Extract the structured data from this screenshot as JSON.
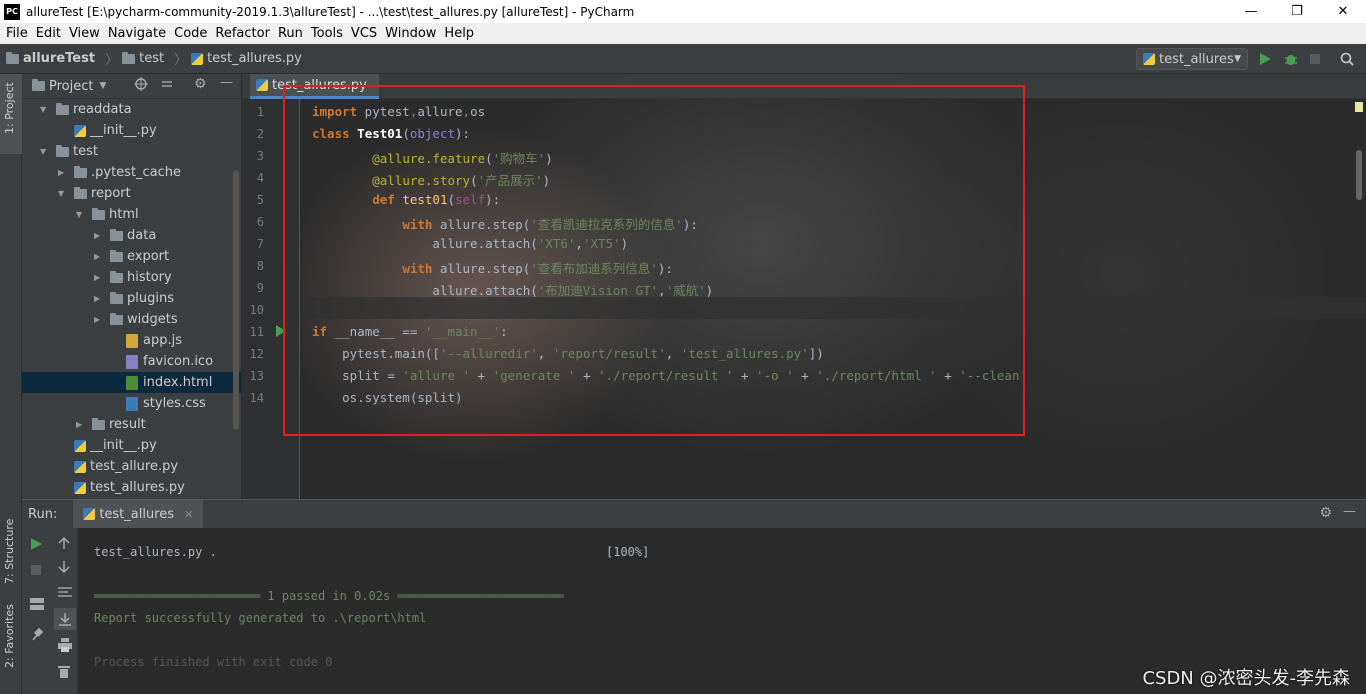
{
  "window": {
    "title": "allureTest [E:\\pycharm-community-2019.1.3\\allureTest] - ...\\test\\test_allures.py [allureTest] - PyCharm",
    "logo_text": "PC",
    "minimize": "—",
    "restore": "❐",
    "close": "✕"
  },
  "menu": [
    "File",
    "Edit",
    "View",
    "Navigate",
    "Code",
    "Refactor",
    "Run",
    "Tools",
    "VCS",
    "Window",
    "Help"
  ],
  "breadcrumb": {
    "project": "allureTest",
    "folder": "test",
    "file": "test_allures.py"
  },
  "run_config": "test_allures",
  "project_panel": {
    "title": "Project",
    "side_tabs": {
      "project": "1: Project",
      "structure": "7: Structure",
      "favorites": "2: Favorites"
    },
    "tree": [
      {
        "label": "readdata",
        "kind": "folder",
        "level": 0,
        "expanded": true
      },
      {
        "label": "__init__.py",
        "kind": "py",
        "level": 1
      },
      {
        "label": "test",
        "kind": "folder",
        "level": 0,
        "expanded": true
      },
      {
        "label": ".pytest_cache",
        "kind": "folder",
        "level": 1,
        "expanded": false
      },
      {
        "label": "report",
        "kind": "folder",
        "level": 1,
        "expanded": true
      },
      {
        "label": "html",
        "kind": "folder",
        "level": 2,
        "expanded": true
      },
      {
        "label": "data",
        "kind": "folder",
        "level": 3,
        "expanded": false
      },
      {
        "label": "export",
        "kind": "folder",
        "level": 3,
        "expanded": false
      },
      {
        "label": "history",
        "kind": "folder",
        "level": 3,
        "expanded": false
      },
      {
        "label": "plugins",
        "kind": "folder",
        "level": 3,
        "expanded": false
      },
      {
        "label": "widgets",
        "kind": "folder",
        "level": 3,
        "expanded": false
      },
      {
        "label": "app.js",
        "kind": "js",
        "level": 4
      },
      {
        "label": "favicon.ico",
        "kind": "ico",
        "level": 4
      },
      {
        "label": "index.html",
        "kind": "html",
        "level": 4,
        "selected": true
      },
      {
        "label": "styles.css",
        "kind": "css",
        "level": 4
      },
      {
        "label": "result",
        "kind": "folder",
        "level": 2,
        "expanded": false
      },
      {
        "label": "__init__.py",
        "kind": "py",
        "level": 1
      },
      {
        "label": "test_allure.py",
        "kind": "py",
        "level": 1
      },
      {
        "label": "test_allures.py",
        "kind": "py",
        "level": 1
      }
    ]
  },
  "editor": {
    "tab": "test_allures.py",
    "line_numbers": [
      "1",
      "2",
      "3",
      "4",
      "5",
      "6",
      "7",
      "8",
      "9",
      "10",
      "11",
      "12",
      "13",
      "14"
    ]
  },
  "run": {
    "label": "Run:",
    "tab": "test_allures",
    "output": {
      "line1_left": "test_allures.py .",
      "line1_right": "[100%]",
      "passed": "═══════════════════════ 1 passed in 0.02s ═══════════════════════",
      "report": "Report successfully generated to .\\report\\html",
      "finished": "Process finished with exit code 0"
    }
  },
  "watermark": "CSDN @浓密头发-李先森"
}
